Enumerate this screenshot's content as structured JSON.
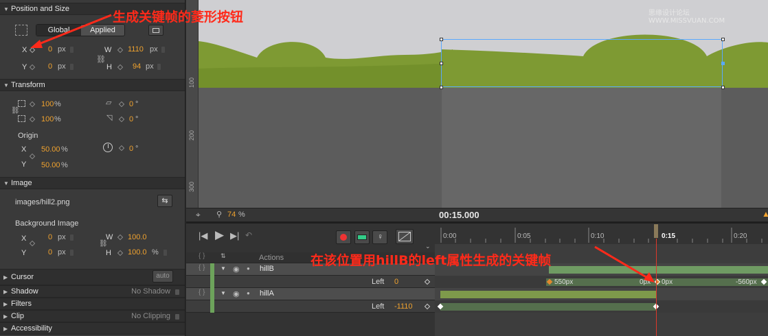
{
  "left_panel": {
    "position_size": {
      "header": "Position and Size",
      "toggle_global": "Global",
      "toggle_applied": "Applied",
      "x_label": "X",
      "x_value": "0",
      "x_unit": "px",
      "y_label": "Y",
      "y_value": "0",
      "y_unit": "px",
      "w_label": "W",
      "w_value": "1110",
      "w_unit": "px",
      "h_label": "H",
      "h_value": "94",
      "h_unit": "px"
    },
    "transform": {
      "header": "Transform",
      "scale_x": "100",
      "scale_y": "100",
      "pct": "%",
      "skew": "0",
      "rotate_x": "0",
      "deg": "°",
      "origin_label": "Origin",
      "origin_x_label": "X",
      "origin_x": "50.00",
      "origin_y_label": "Y",
      "origin_y": "50.00",
      "rotation": "0"
    },
    "image": {
      "header": "Image",
      "path": "images/hill2.png",
      "bg_label": "Background Image",
      "x_label": "X",
      "x_value": "0",
      "x_unit": "px",
      "y_label": "Y",
      "y_value": "0",
      "y_unit": "px",
      "w_label": "W",
      "w_value": "100.0",
      "h_label": "H",
      "h_value": "100.0",
      "h_unit": "%"
    },
    "cursor": {
      "header": "Cursor",
      "auto": "auto"
    },
    "shadow": {
      "header": "Shadow",
      "value": "No Shadow"
    },
    "filters": {
      "header": "Filters"
    },
    "clip": {
      "header": "Clip",
      "value": "No Clipping"
    },
    "accessibility": {
      "header": "Accessibility"
    }
  },
  "stage": {
    "ruler_labels": [
      "100",
      "200",
      "300"
    ],
    "zoom": "74",
    "zoom_unit": "%",
    "time": "00:15.000"
  },
  "timeline": {
    "ticks": [
      "0:00",
      "0:05",
      "0:10",
      "0:15",
      "0:20"
    ],
    "actions_label": "Actions",
    "layers": [
      {
        "name": "hillB",
        "prop": "Left",
        "prop_value": "0",
        "keys": [
          "550px",
          "0px",
          "0px",
          "-560px"
        ]
      },
      {
        "name": "hillA",
        "prop": "Left",
        "prop_value": "-1110"
      }
    ]
  },
  "annotations": {
    "keyframe_button": "生成关键帧的菱形按钮",
    "hillb_keyframe": "在该位置用hillB的left属性生成的关键帧"
  },
  "watermark": "思缘设计论坛 WWW.MISSVUAN.COM",
  "colors": {
    "accent": "#f0a22e",
    "playhead": "#e0392b",
    "annotation": "#ff2a1a",
    "hill": "#7e9a33",
    "track": "#6f9b63"
  }
}
